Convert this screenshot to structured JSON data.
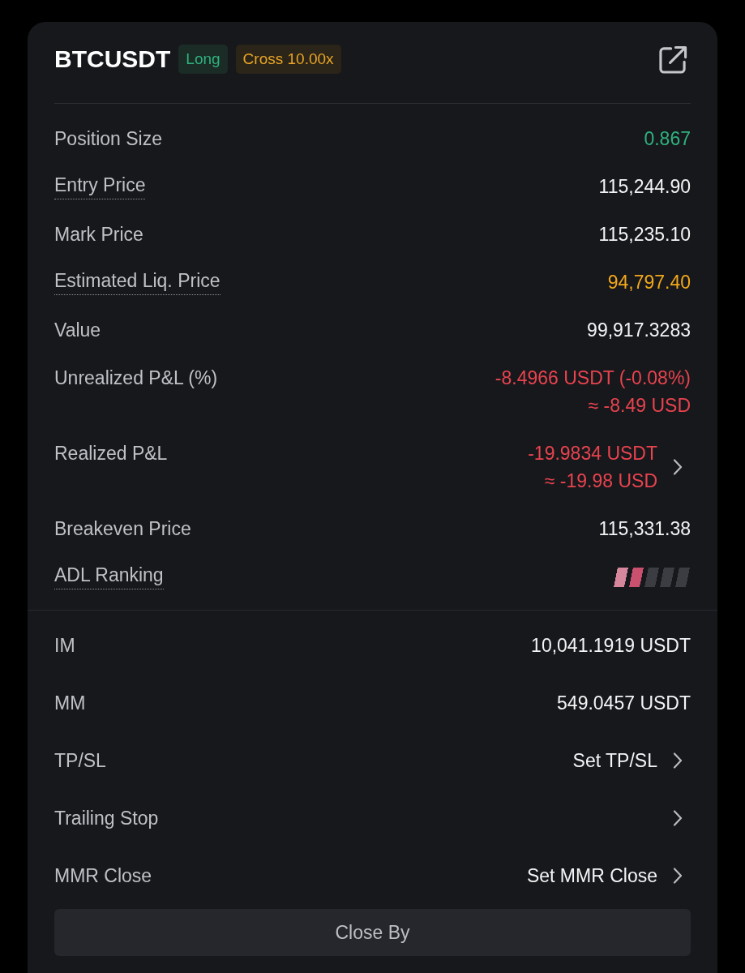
{
  "header": {
    "symbol": "BTCUSDT",
    "badges": [
      {
        "label": "Long",
        "kind": "side"
      },
      {
        "label": "Cross 10.00x",
        "kind": "margin"
      }
    ]
  },
  "details": [
    {
      "kind": "text",
      "label": "Position Size",
      "underlined": false,
      "color": "#2fb27f",
      "chevron": false,
      "values": [
        "0.867"
      ]
    },
    {
      "kind": "text",
      "label": "Entry Price",
      "underlined": true,
      "color": "#f4f4f5",
      "chevron": false,
      "values": [
        "115,244.90"
      ]
    },
    {
      "kind": "text",
      "label": "Mark Price",
      "underlined": false,
      "color": "#f4f4f5",
      "chevron": false,
      "values": [
        "115,235.10"
      ]
    },
    {
      "kind": "text",
      "label": "Estimated Liq. Price",
      "underlined": true,
      "color": "#f2a71b",
      "chevron": false,
      "values": [
        "94,797.40"
      ]
    },
    {
      "kind": "text",
      "label": "Value",
      "underlined": false,
      "color": "#f4f4f5",
      "chevron": false,
      "values": [
        "99,917.3283"
      ]
    },
    {
      "kind": "text",
      "label": "Unrealized P&L (%)",
      "underlined": false,
      "color": "#e8434e",
      "chevron": false,
      "values": [
        "-8.4966 USDT (-0.08%)",
        "≈ -8.49 USD"
      ]
    },
    {
      "kind": "text",
      "label": "Realized P&L",
      "underlined": false,
      "color": "#e8434e",
      "chevron": true,
      "values": [
        "-19.9834 USDT",
        "≈ -19.98 USD"
      ]
    },
    {
      "kind": "text",
      "label": "Breakeven Price",
      "underlined": false,
      "color": "#f4f4f5",
      "chevron": false,
      "values": [
        "115,331.38"
      ]
    },
    {
      "kind": "meter",
      "label": "ADL Ranking",
      "underlined": true,
      "chevron": false,
      "level": 0.4
    }
  ],
  "margins": [
    {
      "label": "IM",
      "value": "10,041.1919 USDT",
      "chevron": false
    },
    {
      "label": "MM",
      "value": "549.0457 USDT",
      "chevron": false
    },
    {
      "label": "TP/SL",
      "value": "Set TP/SL",
      "chevron": true
    },
    {
      "label": "Trailing Stop",
      "chevron": true
    },
    {
      "label": "MMR Close",
      "value": "Set MMR Close",
      "chevron": true
    }
  ],
  "close_button": {
    "label": "Close By"
  }
}
